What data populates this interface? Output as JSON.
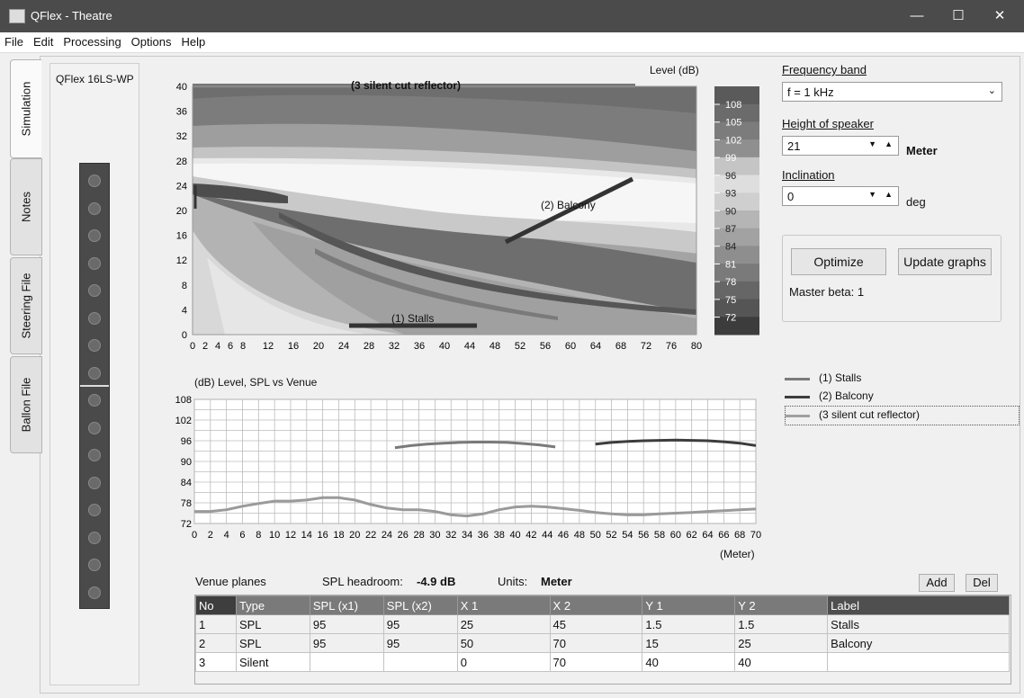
{
  "window": {
    "title": "QFlex - Theatre",
    "minimize": "—",
    "maximize": "☐",
    "close": "✕"
  },
  "menu": [
    "File",
    "Edit",
    "Processing",
    "Options",
    "Help"
  ],
  "tabs": [
    "Simulation",
    "Notes",
    "Steering File",
    "Ballon File"
  ],
  "speaker": {
    "name": "QFlex 16LS-WP"
  },
  "heatmap": {
    "title": "(3 silent cut reflector)",
    "level_label": "Level  (dB)",
    "x_ticks": [
      "0",
      "2",
      "4",
      "6",
      "8",
      "12",
      "16",
      "20",
      "24",
      "28",
      "32",
      "36",
      "40",
      "44",
      "48",
      "52",
      "56",
      "60",
      "64",
      "68",
      "72",
      "76",
      "80"
    ],
    "y_ticks": [
      "40",
      "36",
      "32",
      "28",
      "24",
      "20",
      "16",
      "12",
      "8",
      "4",
      "0"
    ],
    "colorbar_ticks": [
      "108",
      "105",
      "102",
      "99",
      "96",
      "93",
      "90",
      "87",
      "84",
      "81",
      "78",
      "75",
      "72"
    ],
    "labels": {
      "stalls": "(1) Stalls",
      "balcony": "(2) Balcony"
    }
  },
  "chart_data": {
    "type": "line",
    "title": "(dB)  Level, SPL vs Venue",
    "xlabel": "(Meter)",
    "ylim": [
      72,
      108
    ],
    "xlim": [
      0,
      70
    ],
    "y_ticks": [
      "108",
      "102",
      "96",
      "90",
      "84",
      "78",
      "72"
    ],
    "x_ticks": [
      "0",
      "2",
      "4",
      "6",
      "8",
      "10",
      "12",
      "14",
      "16",
      "18",
      "20",
      "22",
      "24",
      "26",
      "28",
      "30",
      "32",
      "34",
      "36",
      "38",
      "40",
      "42",
      "44",
      "46",
      "48",
      "50",
      "52",
      "54",
      "56",
      "58",
      "60",
      "62",
      "64",
      "66",
      "68",
      "70"
    ],
    "series": [
      {
        "name": "(1) Stalls",
        "color": "#7a7a7a",
        "x": [
          25,
          27,
          29,
          31,
          33,
          35,
          37,
          39,
          41,
          43,
          45
        ],
        "y": [
          94.0,
          94.6,
          95.0,
          95.3,
          95.5,
          95.6,
          95.6,
          95.5,
          95.2,
          94.8,
          94.2
        ]
      },
      {
        "name": "(2) Balcony",
        "color": "#3d3d3d",
        "x": [
          50,
          52,
          54,
          56,
          58,
          60,
          62,
          64,
          66,
          68,
          70
        ],
        "y": [
          95.0,
          95.5,
          95.8,
          96.0,
          96.1,
          96.2,
          96.1,
          96.0,
          95.7,
          95.3,
          94.6
        ]
      },
      {
        "name": "(3 silent cut reflector)",
        "color": "#9a9a9a",
        "x": [
          0,
          2,
          4,
          6,
          8,
          10,
          12,
          14,
          16,
          18,
          20,
          22,
          24,
          26,
          28,
          30,
          32,
          34,
          36,
          38,
          40,
          42,
          44,
          46,
          48,
          50,
          52,
          54,
          56,
          58,
          60,
          62,
          64,
          66,
          68,
          70
        ],
        "y": [
          75.5,
          75.5,
          76.0,
          77.0,
          77.8,
          78.5,
          78.5,
          78.8,
          79.5,
          79.5,
          78.8,
          77.5,
          76.5,
          76.0,
          76.0,
          75.5,
          74.5,
          74.2,
          74.8,
          76.0,
          76.8,
          77.0,
          76.8,
          76.3,
          75.8,
          75.2,
          74.8,
          74.5,
          74.5,
          74.8,
          75.0,
          75.2,
          75.5,
          75.7,
          76.0,
          76.2
        ]
      }
    ]
  },
  "legend": [
    "(1) Stalls",
    "(2) Balcony",
    "(3 silent cut reflector)"
  ],
  "controls": {
    "freq_label": "Frequency band",
    "freq_value": "f = 1 kHz",
    "height_label": "Height of speaker",
    "height_value": "21",
    "height_unit": "Meter",
    "incl_label": "Inclination",
    "incl_value": "0",
    "incl_unit": "deg",
    "optimize": "Optimize",
    "update": "Update graphs",
    "master_beta": "Master beta: 1"
  },
  "venue": {
    "title": "Venue planes",
    "headroom_label": "SPL headroom:",
    "headroom_value": "-4.9 dB",
    "units_label": "Units:",
    "units_value": "Meter",
    "add": "Add",
    "del": "Del",
    "columns": [
      "No",
      "Type",
      "SPL (x1)",
      "SPL (x2)",
      "X 1",
      "X 2",
      "Y 1",
      "Y 2",
      "Label"
    ],
    "rows": [
      [
        "1",
        "SPL",
        "95",
        "95",
        "25",
        "45",
        "1.5",
        "1.5",
        "Stalls"
      ],
      [
        "2",
        "SPL",
        "95",
        "95",
        "50",
        "70",
        "15",
        "25",
        "Balcony"
      ],
      [
        "3",
        "Silent",
        "",
        "",
        "0",
        "70",
        "40",
        "40",
        ""
      ]
    ]
  }
}
